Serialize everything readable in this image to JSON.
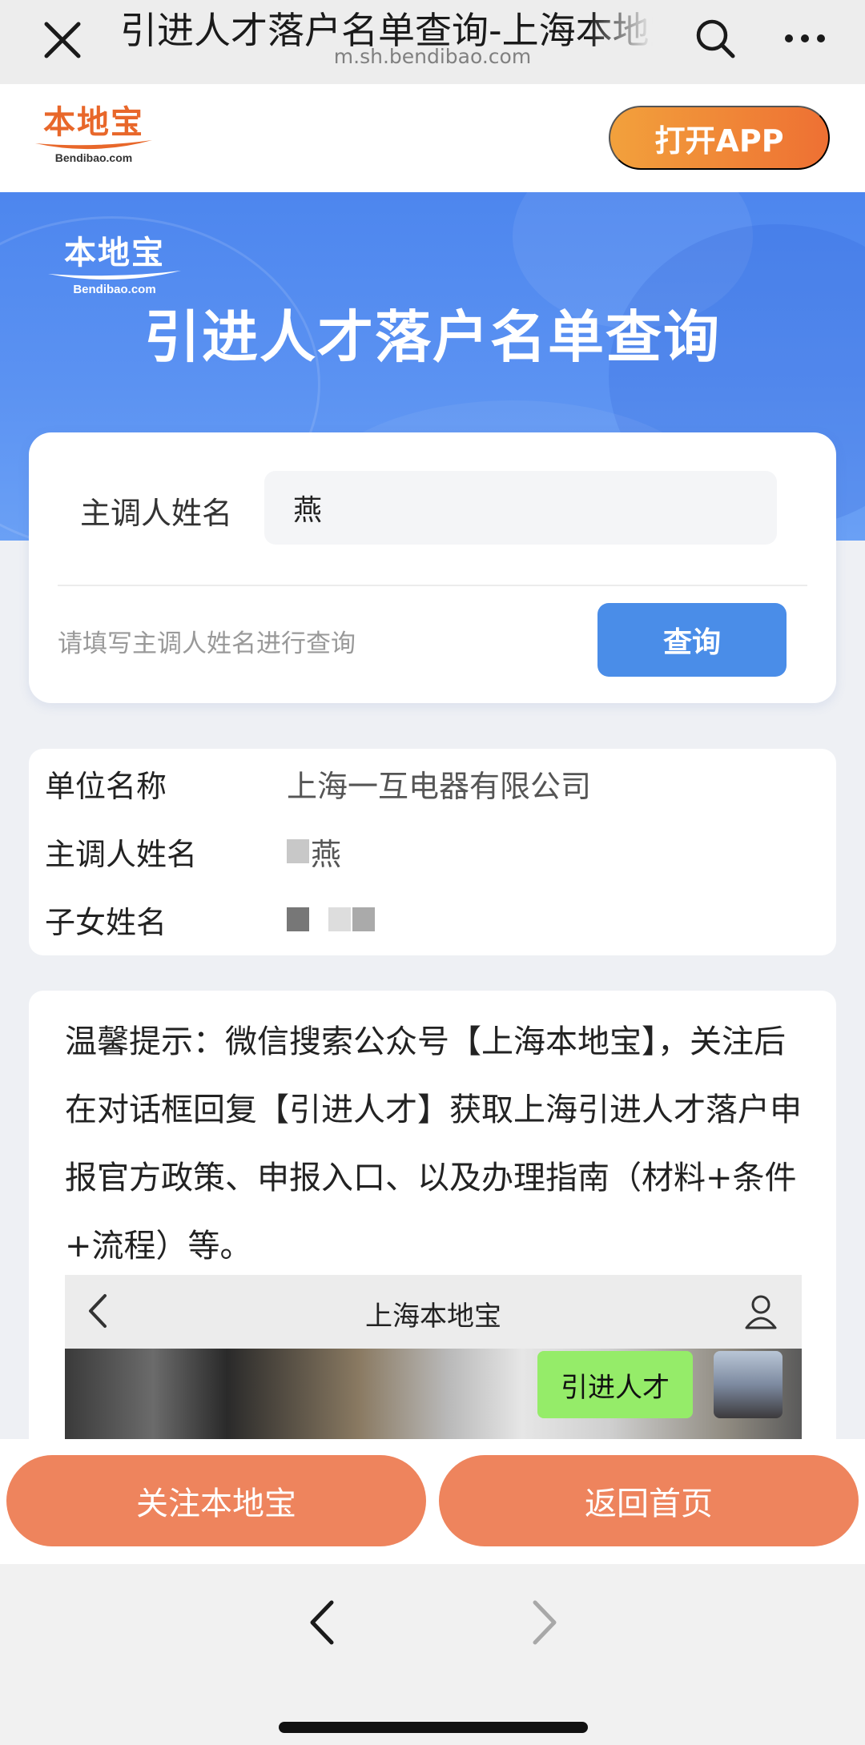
{
  "browser": {
    "title": "引进人才落户名单查询-上海本地宝",
    "url": "m.sh.bendibao.com",
    "icons": [
      "close-icon",
      "search-icon",
      "more-icon"
    ]
  },
  "site_header": {
    "logo_cn": "本地宝",
    "logo_en": "Bendibao.com",
    "open_app_label": "打开APP",
    "accent_color": "#ee7033"
  },
  "hero": {
    "logo_cn": "本地宝",
    "logo_en": "Bendibao.com",
    "title": "引进人才落户名单查询",
    "color": "#4d86ee"
  },
  "search_form": {
    "field_label": "主调人姓名",
    "field_value": "燕",
    "hint": "请填写主调人姓名进行查询",
    "query_label": "查询",
    "button_color": "#4a8de8"
  },
  "result": {
    "rows": [
      {
        "label": "单位名称",
        "value": "上海一互电器有限公司"
      },
      {
        "label": "主调人姓名",
        "value": "燕"
      },
      {
        "label": "子女姓名",
        "value": ""
      }
    ]
  },
  "tip": {
    "text": "温馨提示：微信搜索公众号【上海本地宝】，关注后在对话框回复【引进人才】获取上海引进人才落户申报官方政策、申报入口、以及办理指南（材料+条件+流程）等。",
    "mock_title": "上海本地宝",
    "mock_bubble": "引进人才",
    "bubble_color": "#95ec69"
  },
  "actions": {
    "follow_label": "关注本地宝",
    "home_label": "返回首页",
    "button_color": "#ee845d"
  },
  "nav": {
    "icons": [
      "back-icon",
      "forward-icon"
    ]
  }
}
